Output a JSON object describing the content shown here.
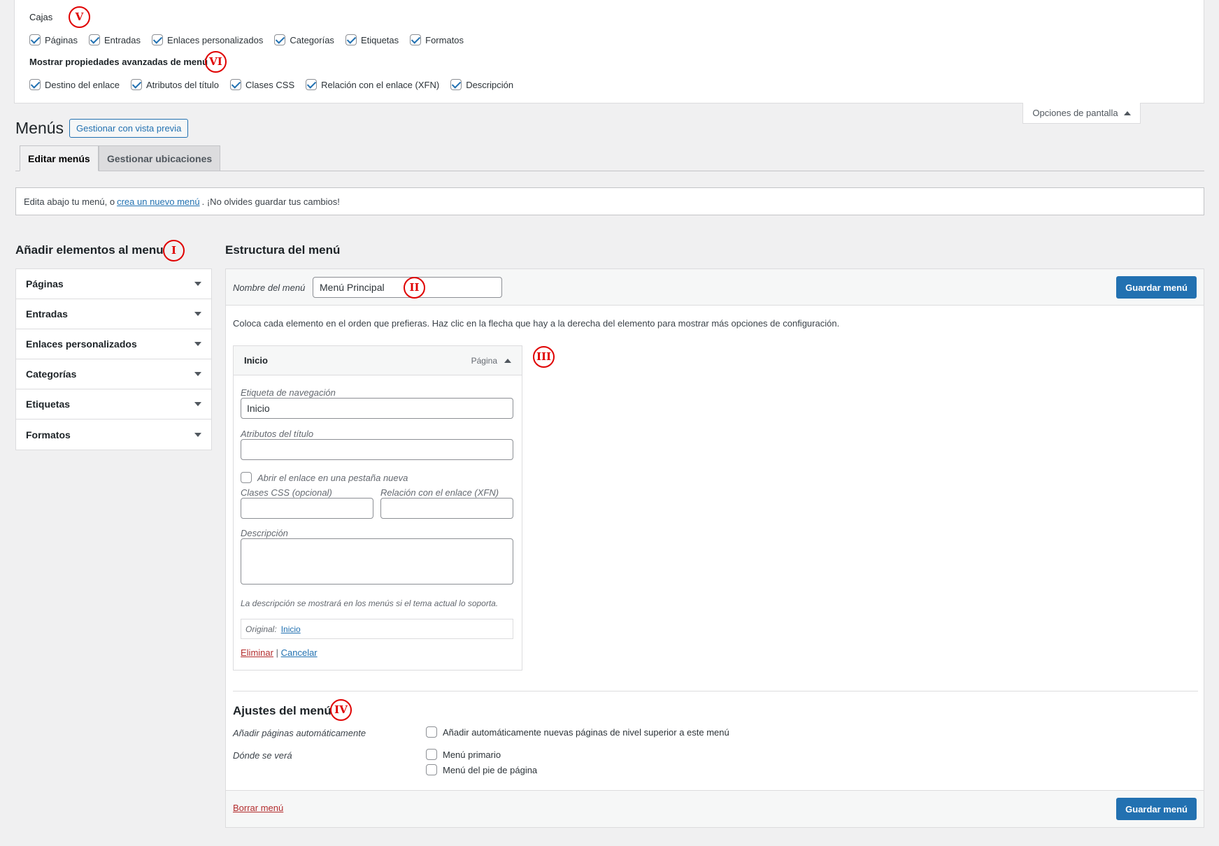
{
  "screen_options": {
    "boxes_title": "Cajas",
    "boxes_badge": "V",
    "boxes": [
      {
        "label": "Páginas",
        "checked": true
      },
      {
        "label": "Entradas",
        "checked": true
      },
      {
        "label": "Enlaces personalizados",
        "checked": true
      },
      {
        "label": "Categorías",
        "checked": true
      },
      {
        "label": "Etiquetas",
        "checked": true
      },
      {
        "label": "Formatos",
        "checked": true
      }
    ],
    "advanced_title": "Mostrar propiedades avanzadas de menú",
    "advanced_badge": "VI",
    "advanced": [
      {
        "label": "Destino del enlace",
        "checked": true
      },
      {
        "label": "Atributos del título",
        "checked": true
      },
      {
        "label": "Clases CSS",
        "checked": true
      },
      {
        "label": "Relación con el enlace (XFN)",
        "checked": true
      },
      {
        "label": "Descripción",
        "checked": true
      }
    ],
    "toggle_label": "Opciones de pantalla"
  },
  "header": {
    "title": "Menús",
    "preview_button": "Gestionar con vista previa"
  },
  "tabs": [
    {
      "label": "Editar menús",
      "active": true
    },
    {
      "label": "Gestionar ubicaciones",
      "active": false
    }
  ],
  "notice": {
    "before": "Edita abajo tu menú, o",
    "link": "crea un nuevo menú",
    "after": ". ¡No olvides guardar tus cambios!"
  },
  "add_items": {
    "title": "Añadir elementos al menu",
    "badge": "I",
    "sections": [
      "Páginas",
      "Entradas",
      "Enlaces personalizados",
      "Categorías",
      "Etiquetas",
      "Formatos"
    ]
  },
  "structure": {
    "title": "Estructura del menú",
    "name_label": "Nombre del menú",
    "name_value": "Menú Principal",
    "name_badge": "II",
    "save_button": "Guardar menú",
    "instructions": "Coloca cada elemento en el orden que prefieras. Haz clic en la flecha que hay a la derecha del elemento para mostrar más opciones de configuración.",
    "item_badge": "III",
    "item": {
      "title": "Inicio",
      "type": "Página",
      "nav_label_label": "Etiqueta de navegación",
      "nav_label_value": "Inicio",
      "title_attr_label": "Atributos del título",
      "title_attr_value": "",
      "new_tab_label": "Abrir el enlace en una pestaña nueva",
      "css_label": "Clases CSS (opcional)",
      "xfn_label": "Relación con el enlace (XFN)",
      "description_label": "Descripción",
      "description_help": "La descripción se mostrará en los menús si el tema actual lo soporta.",
      "original_label": "Original:",
      "original_link": "Inicio",
      "remove": "Eliminar",
      "separator": "|",
      "cancel": "Cancelar"
    },
    "settings": {
      "title": "Ajustes del menú",
      "badge": "IV",
      "auto_add_label": "Añadir páginas automáticamente",
      "auto_add_option": "Añadir automáticamente nuevas páginas de nivel superior a este menú",
      "location_label": "Dónde se verá",
      "locations": [
        "Menú primario",
        "Menú del pie de página"
      ]
    },
    "delete_menu": "Borrar menú"
  }
}
